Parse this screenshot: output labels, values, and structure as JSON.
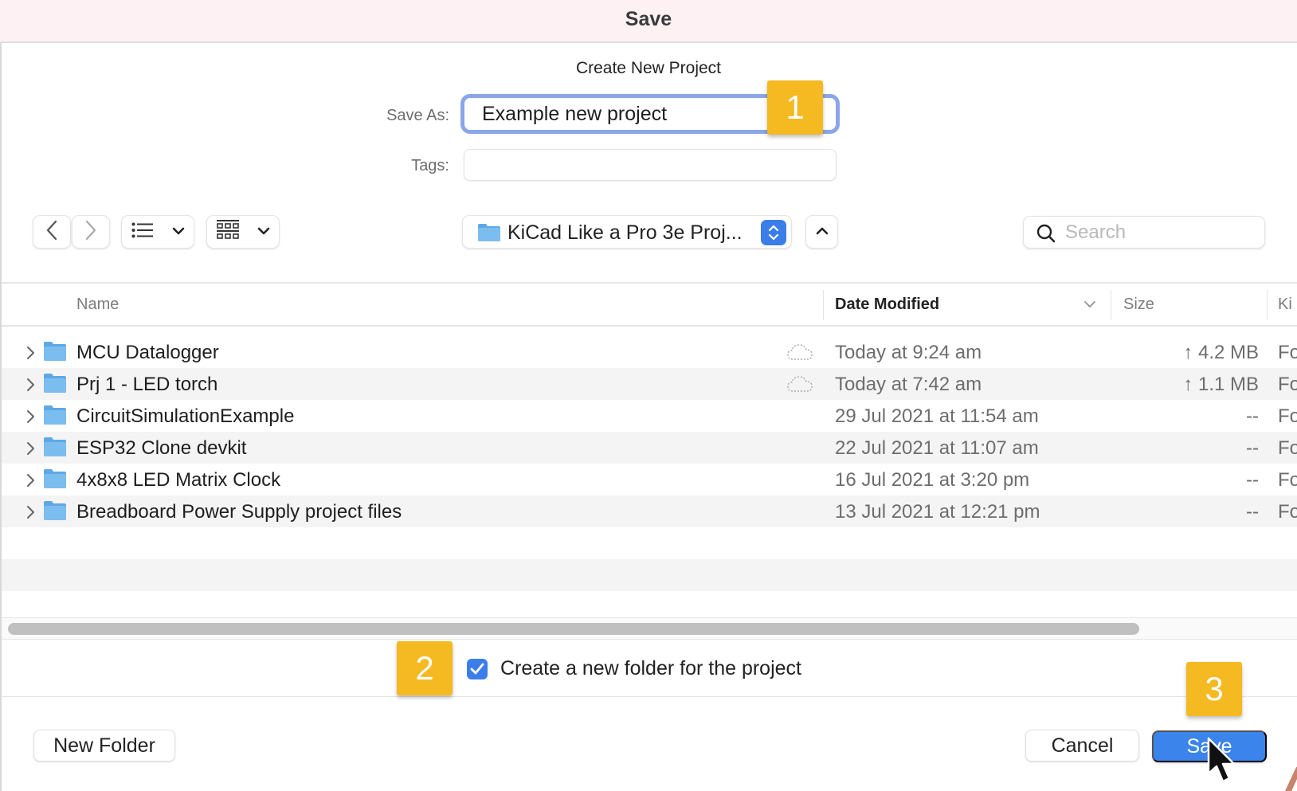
{
  "window": {
    "title": "Save"
  },
  "dialog": {
    "subtitle": "Create New Project",
    "save_as_label": "Save As:",
    "save_as_value": "Example new project",
    "tags_label": "Tags:",
    "tags_value": ""
  },
  "toolbar": {
    "back_icon": "chevron-left-icon",
    "forward_icon": "chevron-right-icon",
    "view_list_icon": "list-view-icon",
    "view_group_icon": "group-view-icon",
    "location": "KiCad Like a Pro 3e Proj...",
    "search_placeholder": "Search"
  },
  "columns": {
    "name": "Name",
    "date_modified": "Date Modified",
    "size": "Size",
    "kind": "Ki",
    "sort_column": "Date Modified",
    "sort_direction": "descending"
  },
  "files": [
    {
      "name": "MCU Datalogger",
      "date": "Today at 9:24 am",
      "size": "↑ 4.2 MB",
      "kind": "Fo",
      "cloud": true
    },
    {
      "name": "Prj 1 - LED torch",
      "date": "Today at 7:42 am",
      "size": "↑ 1.1 MB",
      "kind": "Fo",
      "cloud": true
    },
    {
      "name": "CircuitSimulationExample",
      "date": "29 Jul 2021 at 11:54 am",
      "size": "--",
      "kind": "Fo",
      "cloud": false
    },
    {
      "name": "ESP32 Clone devkit",
      "date": "22 Jul 2021 at 11:07 am",
      "size": "--",
      "kind": "Fo",
      "cloud": false
    },
    {
      "name": "4x8x8 LED Matrix Clock",
      "date": "16 Jul 2021 at 3:20 pm",
      "size": "--",
      "kind": "Fo",
      "cloud": false
    },
    {
      "name": "Breadboard Power Supply project files",
      "date": "13 Jul 2021 at 12:21 pm",
      "size": "--",
      "kind": "Fo",
      "cloud": false
    }
  ],
  "options": {
    "create_folder_label": "Create a new folder for the project",
    "create_folder_checked": true
  },
  "buttons": {
    "new_folder": "New Folder",
    "cancel": "Cancel",
    "save": "Save"
  },
  "annotations": {
    "badge_1": "1",
    "badge_2": "2",
    "badge_3": "3"
  },
  "colors": {
    "accent": "#3b84ec",
    "badge": "#f5b921",
    "focus_ring": "#8aa6e8",
    "titlebar": "#fdf1f4"
  }
}
